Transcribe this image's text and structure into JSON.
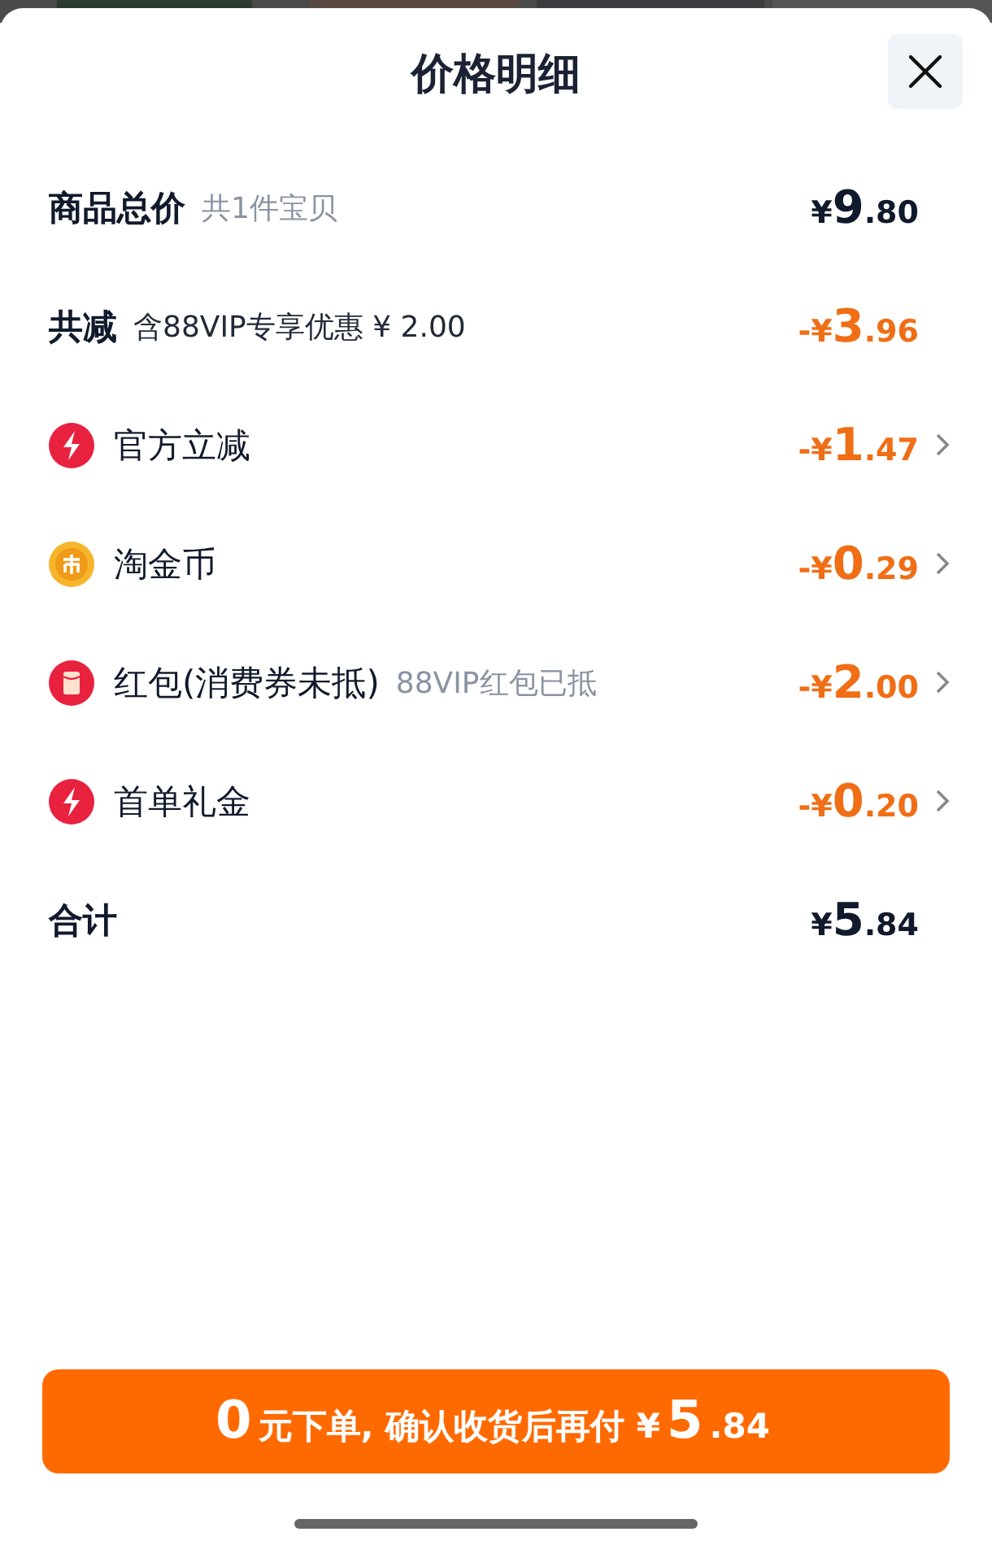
{
  "sheet": {
    "title": "价格明细"
  },
  "rows": [
    {
      "kind": "summary",
      "label": "商品总价",
      "note": "共1件宝贝",
      "price": {
        "sign": "¥",
        "int": "9",
        "dec": ".80"
      },
      "color": "#111a2c"
    },
    {
      "kind": "summary",
      "label": "共减",
      "note": "含88VIP专享优惠 ¥ 2.00",
      "price": {
        "sign": "-¥",
        "int": "3",
        "dec": ".96"
      },
      "color": "#f06e16"
    },
    {
      "kind": "bolt",
      "label": "官方立减",
      "price": {
        "sign": "-¥",
        "int": "1",
        "dec": ".47"
      },
      "color": "#f06e16"
    },
    {
      "kind": "coin",
      "label": "淘金币",
      "price": {
        "sign": "-¥",
        "int": "0",
        "dec": ".29"
      },
      "color": "#f06e16"
    },
    {
      "kind": "envelope",
      "label": "红包(消费券未抵)",
      "note": "88VIP红包已抵",
      "price": {
        "sign": "-¥",
        "int": "2",
        "dec": ".00"
      },
      "color": "#f06e16"
    },
    {
      "kind": "bolt",
      "label": "首单礼金",
      "price": {
        "sign": "-¥",
        "int": "0",
        "dec": ".20"
      },
      "color": "#f06e16"
    },
    {
      "kind": "summary",
      "label": "合计",
      "price": {
        "sign": "¥",
        "int": "5",
        "dec": ".84"
      },
      "color": "#111a2c"
    }
  ],
  "button": {
    "parts": [
      {
        "text": "0",
        "kind": "big"
      },
      {
        "text": "元下单, 确认收货后再付 ¥",
        "kind": "small"
      },
      {
        "text": "5",
        "kind": "big"
      },
      {
        "text": ".84",
        "kind": "small"
      }
    ]
  }
}
